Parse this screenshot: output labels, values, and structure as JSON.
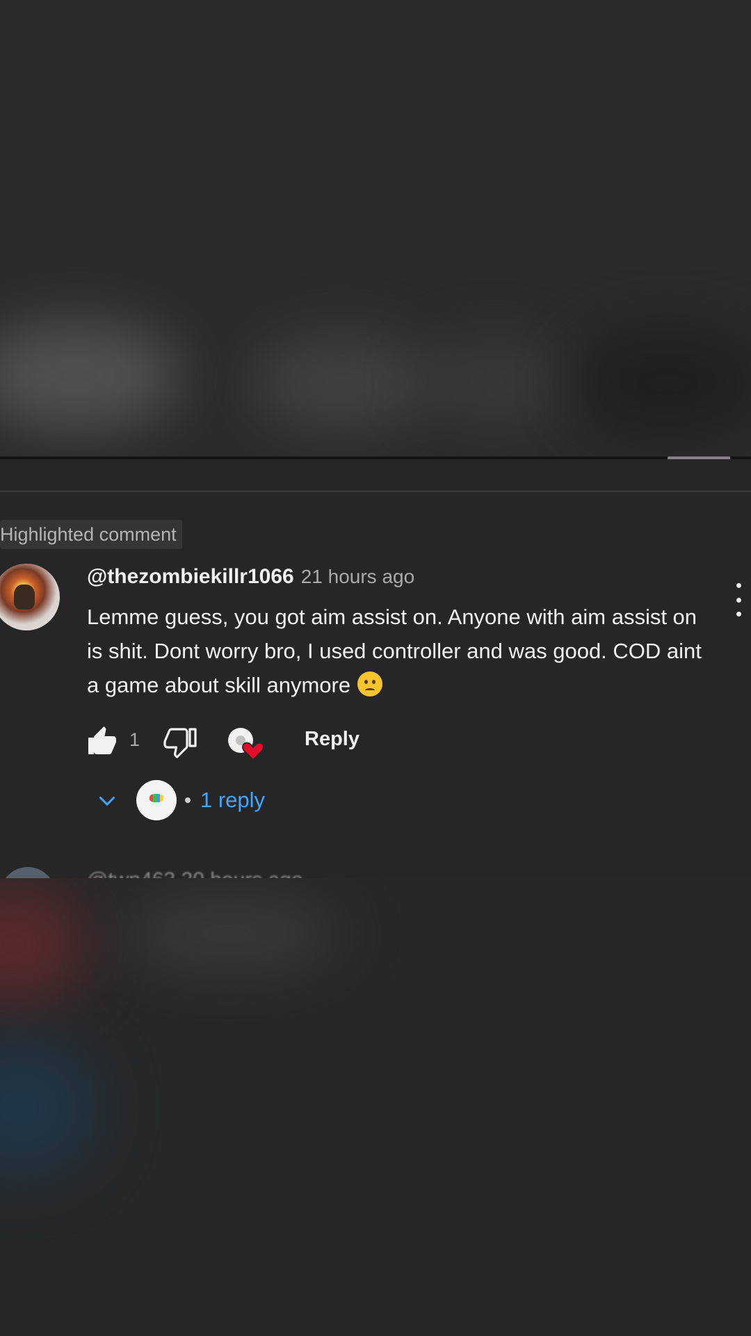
{
  "highlight_badge": "Highlighted comment",
  "comment": {
    "author": "@thezombiekillr1066",
    "time": "21 hours ago",
    "text": "Lemme guess, you got aim assist on. Anyone with aim assist on is shit. Dont worry bro, I used controller and was good. COD aint a game about skill anymore",
    "emoji": "worried-face-emoji",
    "like_count": "1",
    "reply_label": "Reply",
    "replies_label": "1 reply"
  },
  "icons": {
    "like": "thumbs-up-icon",
    "dislike": "thumbs-down-icon",
    "creator_heart": "creator-heart-icon",
    "more": "more-vert-icon",
    "expand": "chevron-down-icon"
  },
  "colors": {
    "background": "#262626",
    "link_blue": "#3ea6ff",
    "heart_red": "#e0102a",
    "secondary_text": "#aaaaaa"
  },
  "next_comment_partial": "@twn463 20 hours ago"
}
